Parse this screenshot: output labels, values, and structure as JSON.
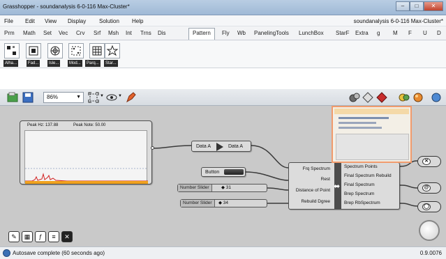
{
  "window": {
    "title": "Grasshopper - soundanalysis 6-0-116 Max-Cluster*",
    "document_name": "soundanalysis 6-0-116 Max-Cluster*",
    "min_label": "–",
    "max_label": "□",
    "close_label": "✕"
  },
  "menu": [
    "File",
    "Edit",
    "View",
    "Display",
    "Solution",
    "Help"
  ],
  "tabs": [
    "Prm",
    "Math",
    "Set",
    "Vec",
    "Crv",
    "Srf",
    "Msh",
    "Int",
    "Trns",
    "Dis",
    "Pattern",
    "Fly",
    "Wb",
    "PanelingTools",
    "LunchBox",
    "StarF",
    "Extra",
    "g",
    "M",
    "F",
    "U",
    "D"
  ],
  "active_tab": "Pattern",
  "component_labels": [
    "Alha...",
    "Fad...",
    "Isle...",
    "Mod...",
    "Parq...",
    "Star..."
  ],
  "canvas_toolbar": {
    "zoom": "86%"
  },
  "canvas": {
    "graph": {
      "header_left": "Peak Hz: 137.88",
      "header_right": "Peak Note: 50.00"
    },
    "data_node": {
      "input": "Data A",
      "output": "Data A"
    },
    "button_label": "Button",
    "sliders": [
      {
        "label": "Number Slider",
        "value": "◆ 31"
      },
      {
        "label": "Number Slider",
        "value": "◆ 34"
      }
    ],
    "cluster": {
      "inputs": [
        "Frq Spectrum",
        "Rest",
        "Distance of Point",
        "Rebuild Dgree"
      ],
      "outputs": [
        "Spectrum Points",
        "Final Spectrum Rebuild",
        "Final Spectrum",
        "Brep Spectrum",
        "Brep RbSpectrum"
      ]
    },
    "params": [
      "✕",
      "@",
      "◯"
    ]
  },
  "status": {
    "text": "Autosave complete (60 seconds ago)",
    "version": "0.9.0076"
  }
}
